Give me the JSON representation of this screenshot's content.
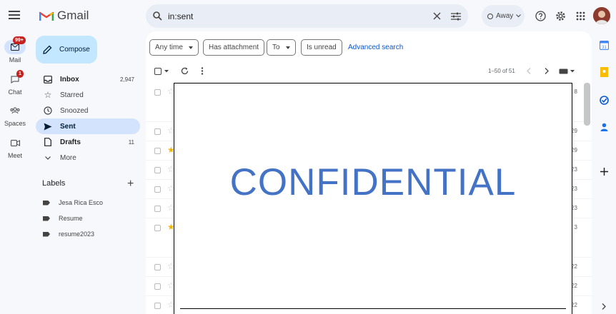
{
  "app": {
    "name": "Gmail"
  },
  "rail": {
    "items": [
      {
        "label": "Mail",
        "badge": "99+"
      },
      {
        "label": "Chat",
        "badge": "1"
      },
      {
        "label": "Spaces"
      },
      {
        "label": "Meet"
      }
    ]
  },
  "search": {
    "value": "in:sent"
  },
  "status": {
    "label": "Away"
  },
  "compose": {
    "label": "Compose"
  },
  "nav": [
    {
      "label": "Inbox",
      "count": "2,947"
    },
    {
      "label": "Starred"
    },
    {
      "label": "Snoozed"
    },
    {
      "label": "Sent"
    },
    {
      "label": "Drafts",
      "count": "11"
    },
    {
      "label": "More"
    }
  ],
  "labels": {
    "title": "Labels",
    "items": [
      "Jesa Rica Esco",
      "Resume",
      "resume2023"
    ]
  },
  "filters": {
    "chips": [
      "Any time",
      "Has attachment",
      "To",
      "Is unread"
    ],
    "advanced": "Advanced search"
  },
  "pager": {
    "range": "1–50 of 51"
  },
  "rows": [
    {
      "starred": false,
      "date": "8"
    },
    {
      "starred": false,
      "date": "29"
    },
    {
      "starred": true,
      "date": "29"
    },
    {
      "starred": false,
      "date": "23"
    },
    {
      "starred": false,
      "date": "23"
    },
    {
      "starred": false,
      "date": "23"
    },
    {
      "starred": true,
      "date": "3"
    },
    {
      "starred": false,
      "date": "22"
    },
    {
      "starred": false,
      "date": "22"
    },
    {
      "starred": false,
      "date": "22"
    }
  ],
  "overlay": {
    "text": "CONFIDENTIAL"
  },
  "colors": {
    "accent": "#0b57d0",
    "compose_bg": "#c2e7ff",
    "active_nav": "#d3e3fd",
    "confidential": "#4472c4",
    "star": "#f4b400"
  }
}
